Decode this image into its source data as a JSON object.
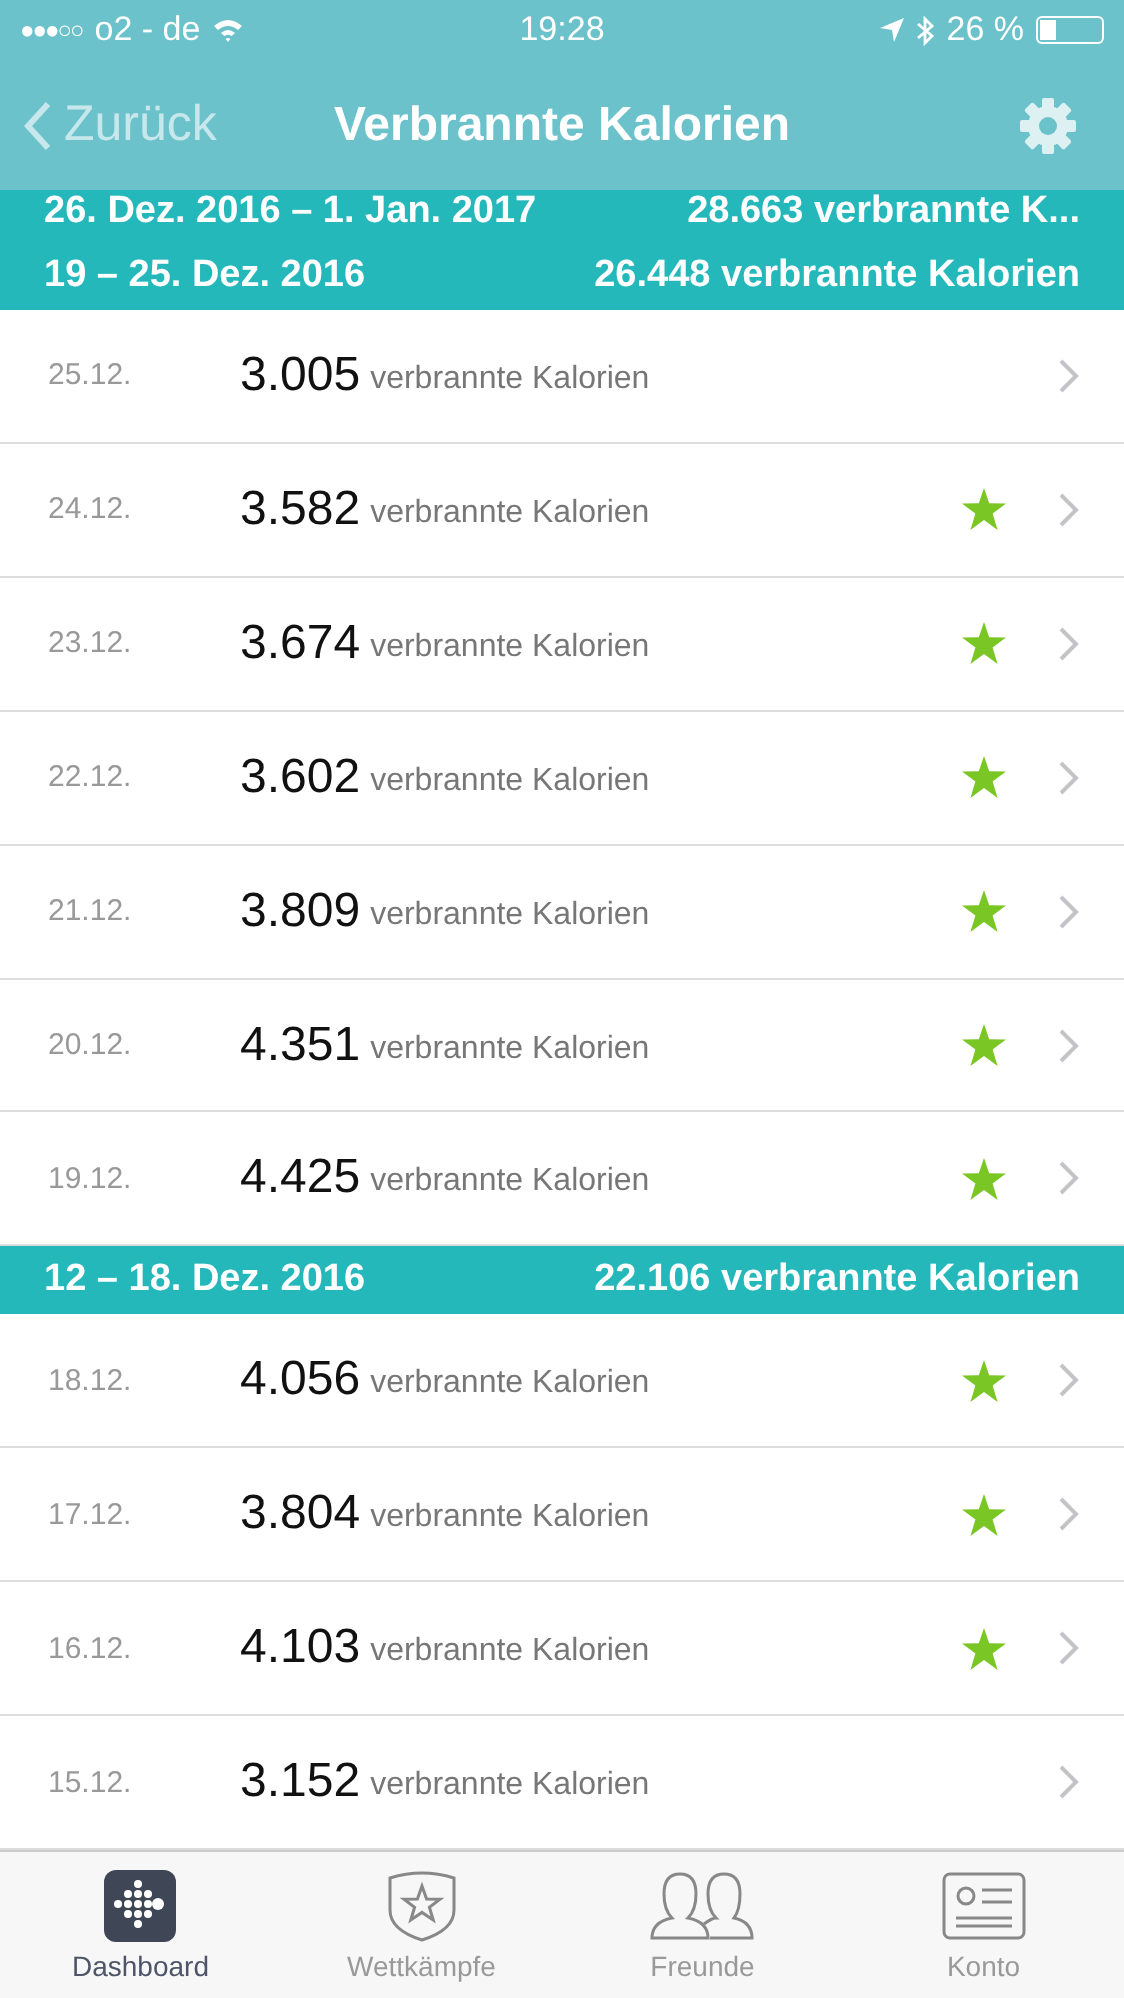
{
  "status_bar": {
    "signal_dots": "●●●○○",
    "carrier": "o2 - de",
    "time": "19:28",
    "battery": "26 %"
  },
  "nav": {
    "back": "Zurück",
    "title": "Verbrannte Kalorien"
  },
  "weeks": [
    {
      "range": "26. Dez. 2016 – 1. Jan. 2017",
      "total": "28.663 verbrannte K..."
    },
    {
      "range": "19 – 25. Dez. 2016",
      "total": "26.448 verbrannte Kalorien",
      "days": [
        {
          "date": "25.12.",
          "value": "3.005",
          "unit": "verbrannte Kalorien",
          "star": false
        },
        {
          "date": "24.12.",
          "value": "3.582",
          "unit": "verbrannte Kalorien",
          "star": true
        },
        {
          "date": "23.12.",
          "value": "3.674",
          "unit": "verbrannte Kalorien",
          "star": true
        },
        {
          "date": "22.12.",
          "value": "3.602",
          "unit": "verbrannte Kalorien",
          "star": true
        },
        {
          "date": "21.12.",
          "value": "3.809",
          "unit": "verbrannte Kalorien",
          "star": true
        },
        {
          "date": "20.12.",
          "value": "4.351",
          "unit": "verbrannte Kalorien",
          "star": true
        },
        {
          "date": "19.12.",
          "value": "4.425",
          "unit": "verbrannte Kalorien",
          "star": true
        }
      ]
    },
    {
      "range": "12 – 18. Dez. 2016",
      "total": "22.106 verbrannte Kalorien",
      "days": [
        {
          "date": "18.12.",
          "value": "4.056",
          "unit": "verbrannte Kalorien",
          "star": true
        },
        {
          "date": "17.12.",
          "value": "3.804",
          "unit": "verbrannte Kalorien",
          "star": true
        },
        {
          "date": "16.12.",
          "value": "4.103",
          "unit": "verbrannte Kalorien",
          "star": true
        },
        {
          "date": "15.12.",
          "value": "3.152",
          "unit": "verbrannte Kalorien",
          "star": false
        }
      ]
    }
  ],
  "tabs": [
    {
      "kind": "dashboard",
      "label": "Dashboard",
      "selected": true
    },
    {
      "kind": "challenges",
      "label": "Wettkämpfe",
      "selected": false
    },
    {
      "kind": "friends",
      "label": "Freunde",
      "selected": false
    },
    {
      "kind": "account",
      "label": "Konto",
      "selected": false
    }
  ]
}
